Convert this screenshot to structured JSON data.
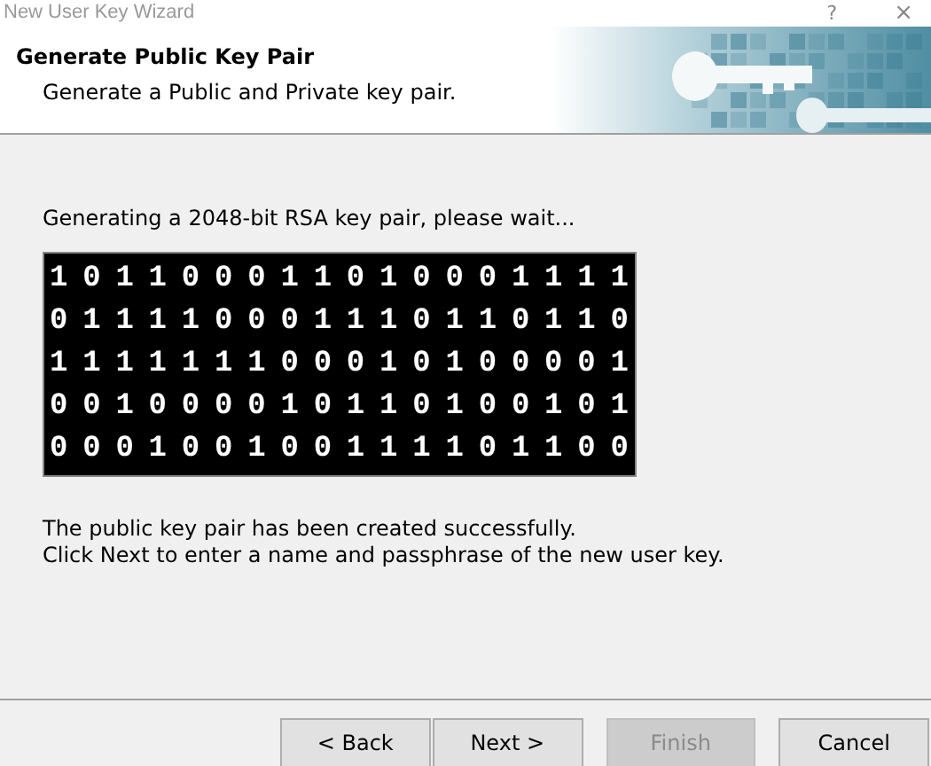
{
  "window": {
    "title": "New User Key Wizard",
    "help": "?",
    "close": "×"
  },
  "header": {
    "title": "Generate Public Key Pair",
    "subtitle": "Generate a Public and Private key pair."
  },
  "status": "Generating a 2048-bit RSA key pair, please wait...",
  "bits": [
    "1 0 1 1 0 0 0 1 1 0 1 0 0 0 1 1 1 1",
    "0 1 1 1 1 0 0 0 1 1 1 0 1 1 0 1 1 0",
    "1 1 1 1 1 1 1 0 0 0 1 0 1 0 0 0 0 1",
    "0 0 1 0 0 0 0 1 0 1 1 0 1 0 0 1 0 1",
    "0 0 0 1 0 0 1 0 0 1 1 1 1 0 1 1 0 0"
  ],
  "result": [
    "The public key pair has been created successfully.",
    "Click Next to enter a name and passphrase of the new user key."
  ],
  "buttons": [
    {
      "label": "< Back",
      "disabled": false
    },
    {
      "label": "Next >",
      "disabled": false
    },
    {
      "label": "Finish",
      "disabled": true
    },
    {
      "label": "Cancel",
      "disabled": false
    }
  ]
}
